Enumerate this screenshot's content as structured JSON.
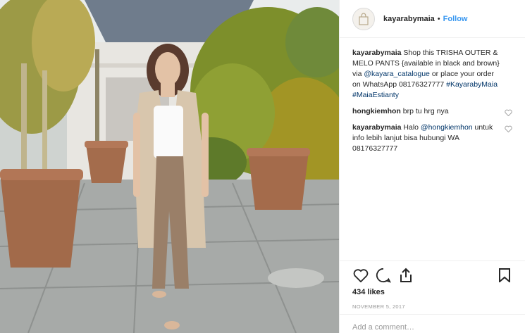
{
  "post": {
    "username": "kayarabymaia",
    "dot": "•",
    "follow_label": "Follow",
    "avatar_icon": "bag-logo-icon",
    "caption": {
      "author": "kayarabymaia",
      "text1": " Shop this TRISHA OUTER & MELO PANTS {available in black and brown} via ",
      "mention": "@kayara_catalogue",
      "text2": " or place your order on WhatsApp 08176327777 ",
      "tag1": "#KayarabyMaia",
      "tag2": "#MaiaEstianty"
    },
    "comments": [
      {
        "author": "hongkiemhon",
        "text": " brp tu hrg nya"
      },
      {
        "author": "kayarabymaia",
        "text_pre": " Halo ",
        "mention": "@hongkiemhon",
        "text_post": " untuk info lebih lanjut bisa hubungi WA 08176327777"
      }
    ],
    "likes": "434 likes",
    "date": "November 5, 2017",
    "add_comment_placeholder": "Add a comment…"
  },
  "colors": {
    "link": "#003569",
    "follow": "#3897f0",
    "muted": "#999999"
  },
  "icons": [
    "heart-icon",
    "comment-icon",
    "share-icon",
    "bookmark-icon",
    "small-heart-icon"
  ]
}
